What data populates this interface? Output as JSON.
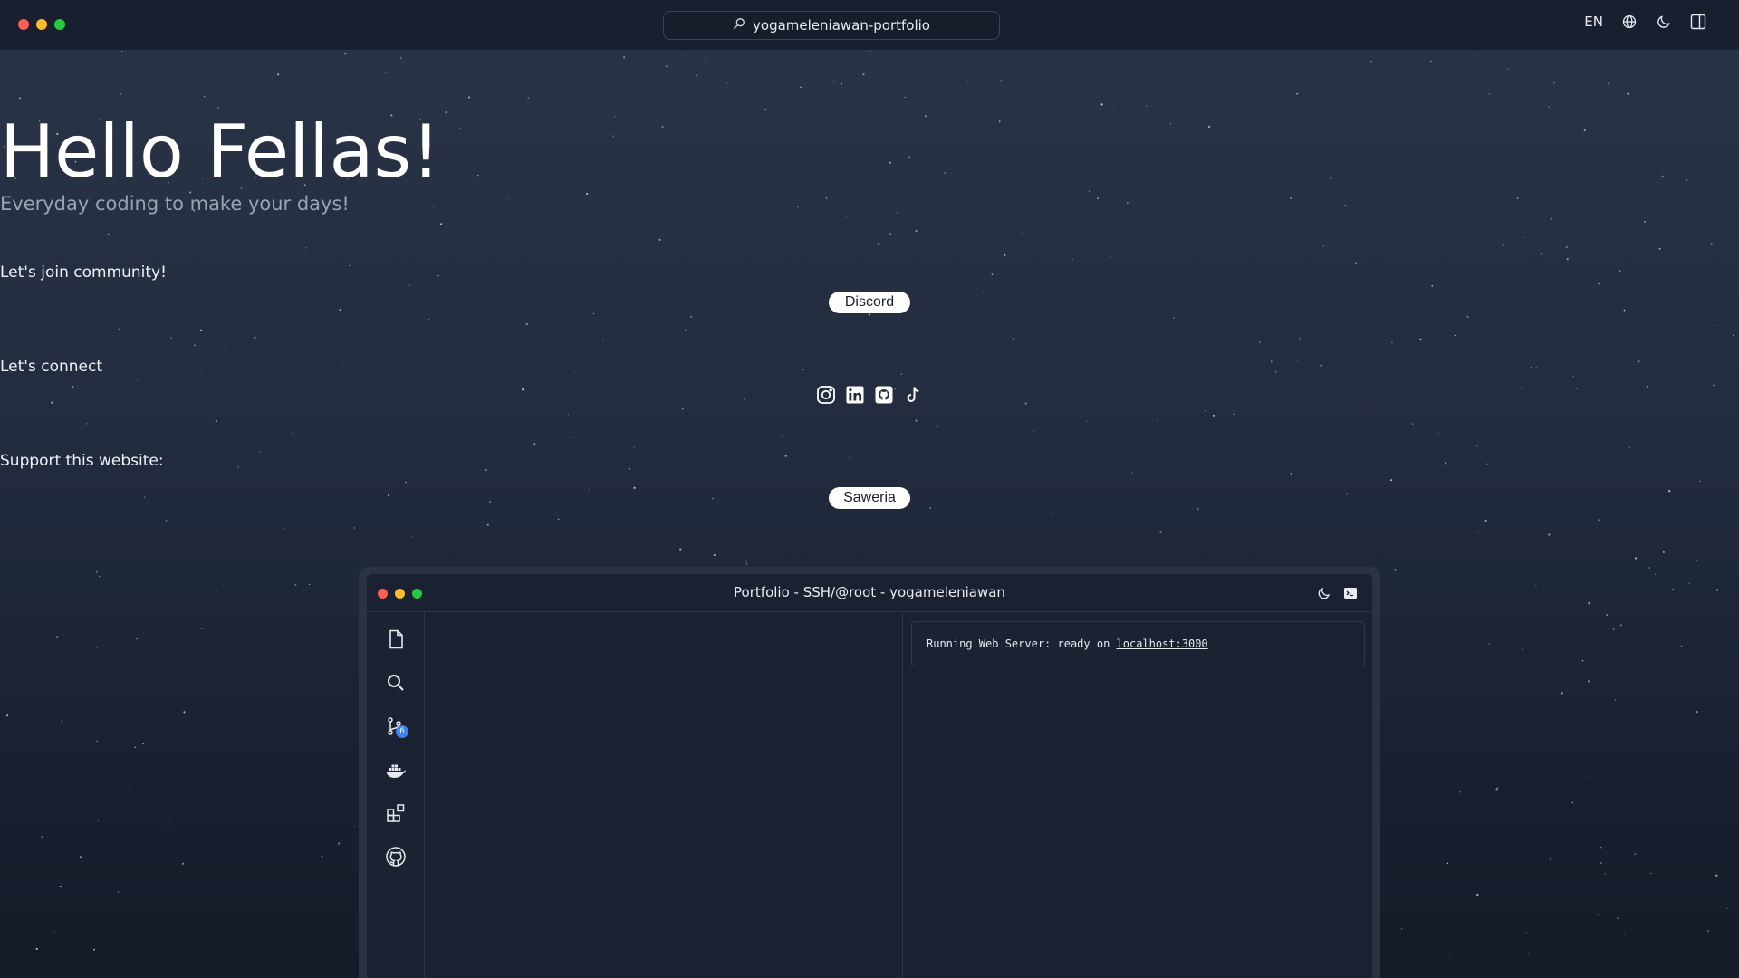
{
  "browser": {
    "address": "yogameleniawan-portfolio",
    "language": "EN"
  },
  "hero": {
    "title": "Hello Fellas!",
    "tagline": "Everyday coding to make your days!"
  },
  "community": {
    "label": "Let's join community!",
    "button": "Discord"
  },
  "connect": {
    "label": "Let's connect",
    "icons": [
      "instagram-icon",
      "linkedin-icon",
      "github-icon",
      "tiktok-icon"
    ]
  },
  "support": {
    "label": "Support this website:",
    "button": "Saweria"
  },
  "window": {
    "title": "Portfolio - SSH/@root - yogameleniawan",
    "activity_icons": [
      "file-icon",
      "search-icon",
      "git-branch-icon",
      "docker-icon",
      "extensions-icon",
      "github-icon"
    ],
    "git_badge": "6",
    "terminal": {
      "prefix": "Running Web Server: ready on ",
      "link": "localhost:3000"
    }
  },
  "colors": {
    "background": "#232c3e",
    "topbar": "#182030",
    "accent_badge": "#3b82f6",
    "traffic_red": "#ff5f57",
    "traffic_yellow": "#febc2e",
    "traffic_green": "#28c840"
  }
}
